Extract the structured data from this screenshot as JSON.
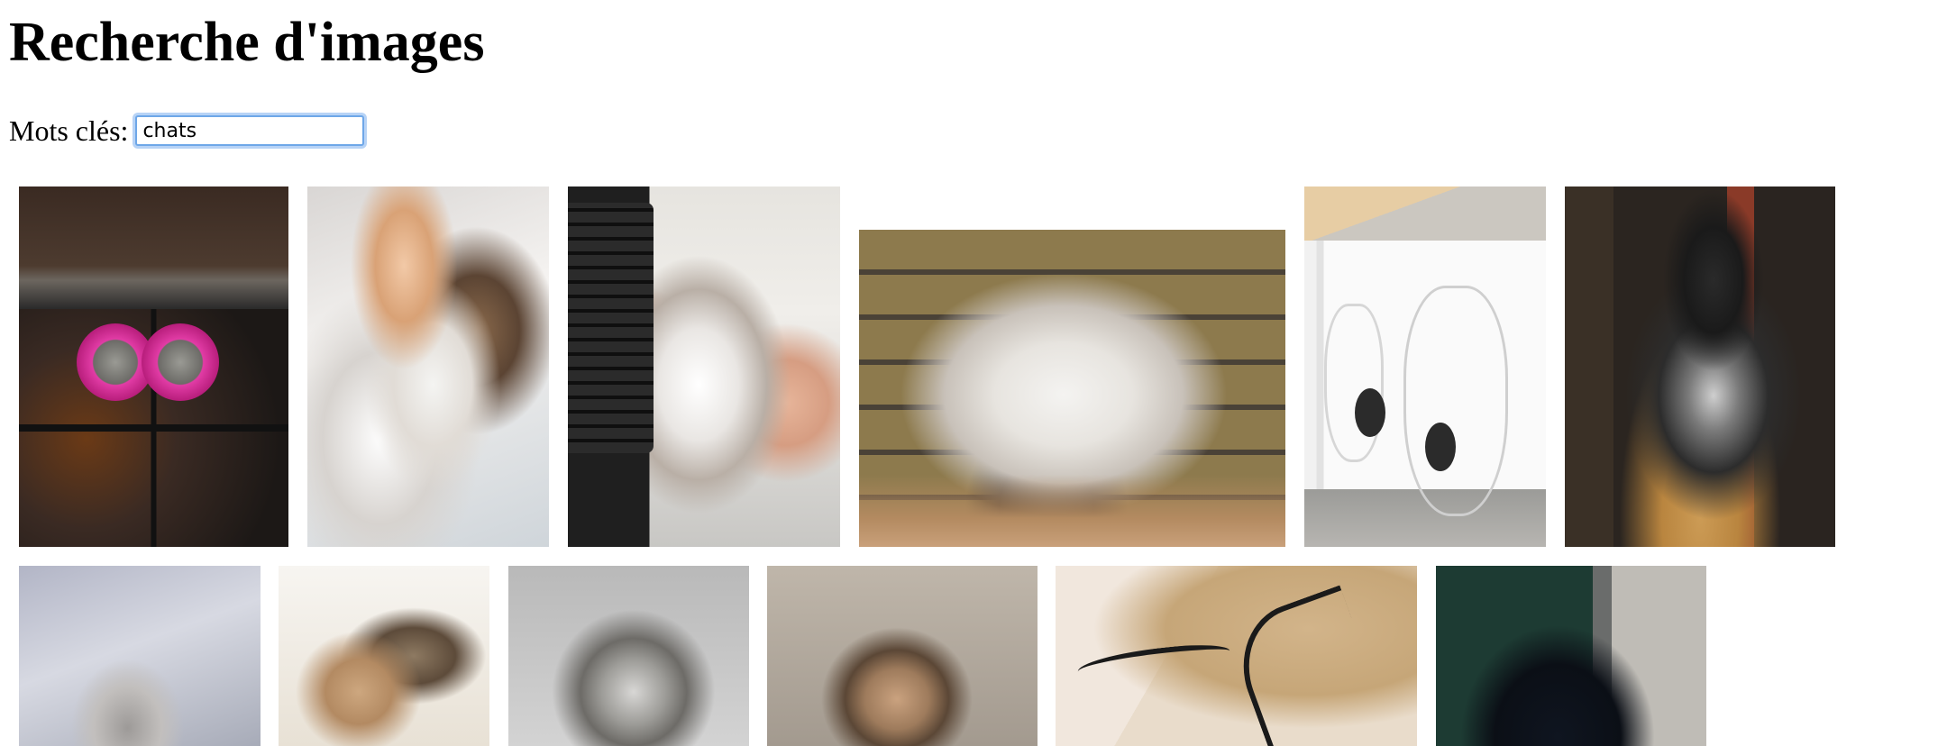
{
  "page": {
    "title": "Recherche d'images"
  },
  "search": {
    "label": "Mots clés:",
    "value": "chats"
  },
  "results": [
    {
      "icon": "cat-photo-food-bowls"
    },
    {
      "icon": "cat-photo-kittens-cuddling"
    },
    {
      "icon": "cat-photo-cat-on-desk-keyboard"
    },
    {
      "icon": "cat-photo-white-fluffy-cat"
    },
    {
      "icon": "cat-photo-cabinet-cat-door"
    },
    {
      "icon": "cat-photo-marbled-cat"
    },
    {
      "icon": "cat-photo-sleeping-cat"
    },
    {
      "icon": "cat-photo-kitten-with-toy"
    },
    {
      "icon": "cat-photo-gray-longhair-cat"
    },
    {
      "icon": "cat-photo-small-kitten"
    },
    {
      "icon": "cat-drawing-illustration"
    },
    {
      "icon": "cat-photo-black-cat"
    }
  ]
}
